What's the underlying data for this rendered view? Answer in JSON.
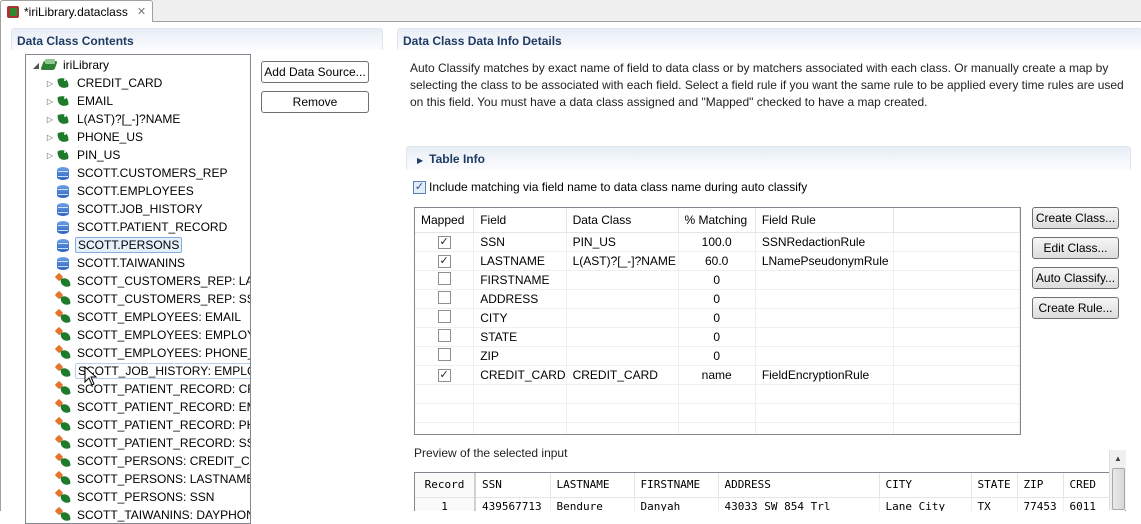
{
  "editor_tab": {
    "title": "*iriLibrary.dataclass",
    "icon": "dataclass-file-icon",
    "close_icon": "close-icon"
  },
  "left_panel": {
    "title": "Data Class Contents",
    "tree": [
      {
        "label": "iriLibrary",
        "icon": "library-icon",
        "level": 0,
        "expander": "expanded"
      },
      {
        "label": "CREDIT_CARD",
        "icon": "data-class-tag-icon",
        "level": 1,
        "expander": "collapsed"
      },
      {
        "label": "EMAIL",
        "icon": "data-class-tag-icon",
        "level": 1,
        "expander": "collapsed"
      },
      {
        "label": "L(AST)?[_-]?NAME",
        "icon": "data-class-tag-icon",
        "level": 1,
        "expander": "collapsed"
      },
      {
        "label": "PHONE_US",
        "icon": "data-class-tag-icon",
        "level": 1,
        "expander": "collapsed"
      },
      {
        "label": "PIN_US",
        "icon": "data-class-tag-icon",
        "level": 1,
        "expander": "collapsed"
      },
      {
        "label": "SCOTT.CUSTOMERS_REP",
        "icon": "database-icon",
        "level": 1
      },
      {
        "label": "SCOTT.EMPLOYEES",
        "icon": "database-icon",
        "level": 1
      },
      {
        "label": "SCOTT.JOB_HISTORY",
        "icon": "database-icon",
        "level": 1
      },
      {
        "label": "SCOTT.PATIENT_RECORD",
        "icon": "database-icon",
        "level": 1
      },
      {
        "label": "SCOTT.PERSONS",
        "icon": "database-icon",
        "level": 1,
        "selected": true
      },
      {
        "label": "SCOTT.TAIWANINS",
        "icon": "database-icon",
        "level": 1
      },
      {
        "label": "SCOTT_CUSTOMERS_REP: LASTNAME",
        "icon": "field-map-icon",
        "level": 1
      },
      {
        "label": "SCOTT_CUSTOMERS_REP: SSN",
        "icon": "field-map-icon",
        "level": 1
      },
      {
        "label": "SCOTT_EMPLOYEES: EMAIL",
        "icon": "field-map-icon",
        "level": 1
      },
      {
        "label": "SCOTT_EMPLOYEES: EMPLOYEE_",
        "icon": "field-map-icon",
        "level": 1
      },
      {
        "label": "SCOTT_EMPLOYEES: PHONE_NU",
        "icon": "field-map-icon",
        "level": 1
      },
      {
        "label": "SCOTT_JOB_HISTORY: EMPLOYE",
        "icon": "field-map-icon",
        "level": 1,
        "hover": true
      },
      {
        "label": "SCOTT_PATIENT_RECORD: CRED",
        "icon": "field-map-icon",
        "level": 1
      },
      {
        "label": "SCOTT_PATIENT_RECORD: EMAI",
        "icon": "field-map-icon",
        "level": 1
      },
      {
        "label": "SCOTT_PATIENT_RECORD: PHOI",
        "icon": "field-map-icon",
        "level": 1
      },
      {
        "label": "SCOTT_PATIENT_RECORD: SSN",
        "icon": "field-map-icon",
        "level": 1
      },
      {
        "label": "SCOTT_PERSONS: CREDIT_CARD",
        "icon": "field-map-icon",
        "level": 1
      },
      {
        "label": "SCOTT_PERSONS: LASTNAME",
        "icon": "field-map-icon",
        "level": 1
      },
      {
        "label": "SCOTT_PERSONS: SSN",
        "icon": "field-map-icon",
        "level": 1
      },
      {
        "label": "SCOTT_TAIWANINS: DAYPHONE",
        "icon": "field-map-icon",
        "level": 1
      }
    ],
    "buttons": {
      "add_data_source": "Add Data Source...",
      "remove": "Remove"
    }
  },
  "right_panel": {
    "title": "Data Class Data Info Details",
    "description": "Auto Classify matches by exact name of field to data class or by matchers associated with each class. Or manually create a map by selecting the class to be associated with each field. Select a field rule if you want the same rule to be applied every time rules are used on this field. You must have a data class assigned and \"Mapped\" checked to have a map created.",
    "table_info": {
      "title": "Table Info",
      "include_matching": {
        "label": "Include matching via field name to data class name during auto classify",
        "checked": true
      },
      "columns": [
        "Mapped",
        "Field",
        "Data Class",
        "% Matching",
        "Field Rule",
        ""
      ],
      "rows": [
        {
          "mapped": true,
          "field": "SSN",
          "data_class": "PIN_US",
          "matching": "100.0",
          "rule": "SSNRedactionRule"
        },
        {
          "mapped": true,
          "field": "LASTNAME",
          "data_class": "L(AST)?[_-]?NAME",
          "matching": "60.0",
          "rule": "LNamePseudonymRule"
        },
        {
          "mapped": false,
          "field": "FIRSTNAME",
          "data_class": "",
          "matching": "0",
          "rule": ""
        },
        {
          "mapped": false,
          "field": "ADDRESS",
          "data_class": "",
          "matching": "0",
          "rule": ""
        },
        {
          "mapped": false,
          "field": "CITY",
          "data_class": "",
          "matching": "0",
          "rule": ""
        },
        {
          "mapped": false,
          "field": "STATE",
          "data_class": "",
          "matching": "0",
          "rule": ""
        },
        {
          "mapped": false,
          "field": "ZIP",
          "data_class": "",
          "matching": "0",
          "rule": ""
        },
        {
          "mapped": true,
          "field": "CREDIT_CARD",
          "data_class": "CREDIT_CARD",
          "matching": "name",
          "rule": "FieldEncryptionRule"
        }
      ],
      "buttons": {
        "create_class": "Create Class...",
        "edit_class": "Edit Class...",
        "auto_classify": "Auto Classify...",
        "create_rule": "Create Rule..."
      }
    },
    "preview": {
      "label": "Preview of the selected input",
      "columns": [
        "Record",
        "SSN",
        "LASTNAME",
        "FIRSTNAME",
        "ADDRESS",
        "CITY",
        "STATE",
        "ZIP",
        "CRED"
      ],
      "rows": [
        [
          "1",
          "439567713",
          "Bendure",
          "Danyah",
          "43033 SW 854 Trl",
          "Lane City",
          "TX",
          "77453",
          "6011"
        ]
      ]
    }
  }
}
